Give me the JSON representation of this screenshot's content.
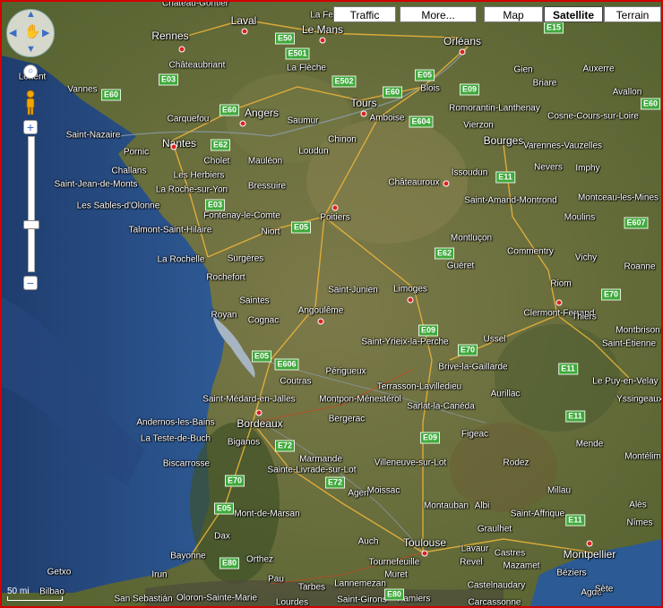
{
  "controls": {
    "traffic": "Traffic",
    "more": "More...",
    "map": "Map",
    "satellite": "Satellite",
    "terrain": "Terrain",
    "zoom_in": "+",
    "zoom_out": "−"
  },
  "scale_label": "50 mi",
  "cities": [
    "Rennes",
    "Laval",
    "Le Mans",
    "Orléans",
    "Vannes",
    "Lorient",
    "Angers",
    "Tours",
    "Blois",
    "Bourges",
    "Nantes",
    "Saint-Nazaire",
    "Cholet",
    "Bressuire",
    "La Roche-sur-Yon",
    "Châteauroux",
    "Poitiers",
    "Niort",
    "La Rochelle",
    "Limoges",
    "Angoulême",
    "Clermont-Ferrand",
    "Brive-la-Gaillarde",
    "Saint-Étienne",
    "Bordeaux",
    "Bergerac",
    "Villeneuve-sur-Lot",
    "Montauban",
    "Albi",
    "Toulouse",
    "Montpellier",
    "Bayonne",
    "Pau",
    "Carcassonne",
    "Béziers",
    "Castres",
    "Rodez",
    "Aurillac",
    "Millau",
    "Nîmes",
    "Agde"
  ],
  "minor_places": [
    "Château-Gontier",
    "La Ferté-B",
    "Châteaubriant",
    "La Flèche",
    "Saumur",
    "Amboise",
    "Chinon",
    "Loudun",
    "Romorantin-Lanthenay",
    "Vierzon",
    "Issoudun",
    "Saint-Amand-Montrond",
    "Montluçon",
    "Commentry",
    "Vichy",
    "Moulins",
    "Montceau-les-Mines",
    "Roanne",
    "Riom",
    "Thiers",
    "Montbrison",
    "Le Puy-en-Velay",
    "Yssingeaux",
    "Gien",
    "Briare",
    "Auxerre",
    "Avallon",
    "Cosne-Cours-sur-Loire",
    "Nevers",
    "Imphy",
    "Varennes-Vauzelles",
    "Carquefou",
    "Pornic",
    "Challans",
    "Les Herbiers",
    "Mauléon",
    "Les Sables-d'Olonne",
    "Saint-Jean-de-Monts",
    "Fontenay-le-Comte",
    "Talmont-Saint-Hilaire",
    "Surgères",
    "Rochefort",
    "Saintes",
    "Royan",
    "Cognac",
    "Saint-Junien",
    "Guéret",
    "Ussel",
    "Saint-Yrieix-la-Perche",
    "Périgueux",
    "Terrasson-Lavilledieu",
    "Coutras",
    "Saint-Médard-en-Jalles",
    "Montpon-Ménestérol",
    "Sarlat-la-Canéda",
    "Figeac",
    "Andernos-les-Bains",
    "La Teste-de-Buch",
    "Biganos",
    "Biscarrosse",
    "Marmande",
    "Sainte-Livrade-sur-Lot",
    "Agen",
    "Moissac",
    "Mont-de-Marsan",
    "Dax",
    "Orthez",
    "Auch",
    "Lavaur",
    "Graulhet",
    "Mazamet",
    "Castelnaudary",
    "Revel",
    "Tournefeuille",
    "Muret",
    "Saint-Girons",
    "Oloron-Sainte-Marie",
    "Tarbes",
    "Lourdes",
    "Lannemezan",
    "Irun",
    "Bilbao",
    "Getxo",
    "San Sebastián",
    "Sète",
    "Alès",
    "Mende",
    "Saint-Affrique",
    "Pamiers",
    "Montélimar"
  ],
  "roads": [
    "E50",
    "E501",
    "E502",
    "E03",
    "E60",
    "E05",
    "E604",
    "E62",
    "E09",
    "E15",
    "E11",
    "E607",
    "E70",
    "E606",
    "E72",
    "E80"
  ]
}
